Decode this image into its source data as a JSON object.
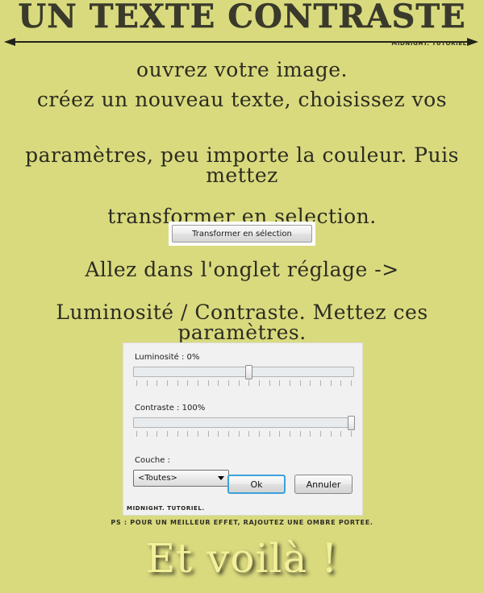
{
  "page": {
    "background_color": "#d9da7e",
    "title": "Un texte contraste",
    "watermark": "MIDNIGHT. TUTORIEL."
  },
  "steps": {
    "paragraph_1": [
      "ouvrez votre image.",
      "créez un nouveau texte, choisissez vos"
    ],
    "paragraph_2": [
      "paramètres, peu importe la couleur. Puis mettez",
      "transformer en selection."
    ],
    "paragraph_3": [
      "Allez dans l'onglet réglage ->",
      "Luminosité / Contraste. Mettez ces paramètres."
    ]
  },
  "transform_button": {
    "label": "Transformer en sélection"
  },
  "dialog": {
    "luminosity": {
      "label": "Luminosité : 0%",
      "value": 0,
      "percent_position": 52
    },
    "contrast": {
      "label": "Contraste : 100%",
      "value": 100,
      "percent_position": 100
    },
    "channel": {
      "label": "Couche :",
      "selected": "<Toutes>"
    },
    "ok_button": "Ok",
    "cancel_button": "Annuler",
    "watermark": "MIDNIGHT. TUTORIEL.",
    "accent_color": "#3ca2dc"
  },
  "footer": {
    "ps_note": "PS : POUR UN MEILLEUR EFFET, RAJOUTEZ UNE OMBRE PORTEE.",
    "closing": "Et voilà !",
    "closing_color": "#f2f09a"
  }
}
